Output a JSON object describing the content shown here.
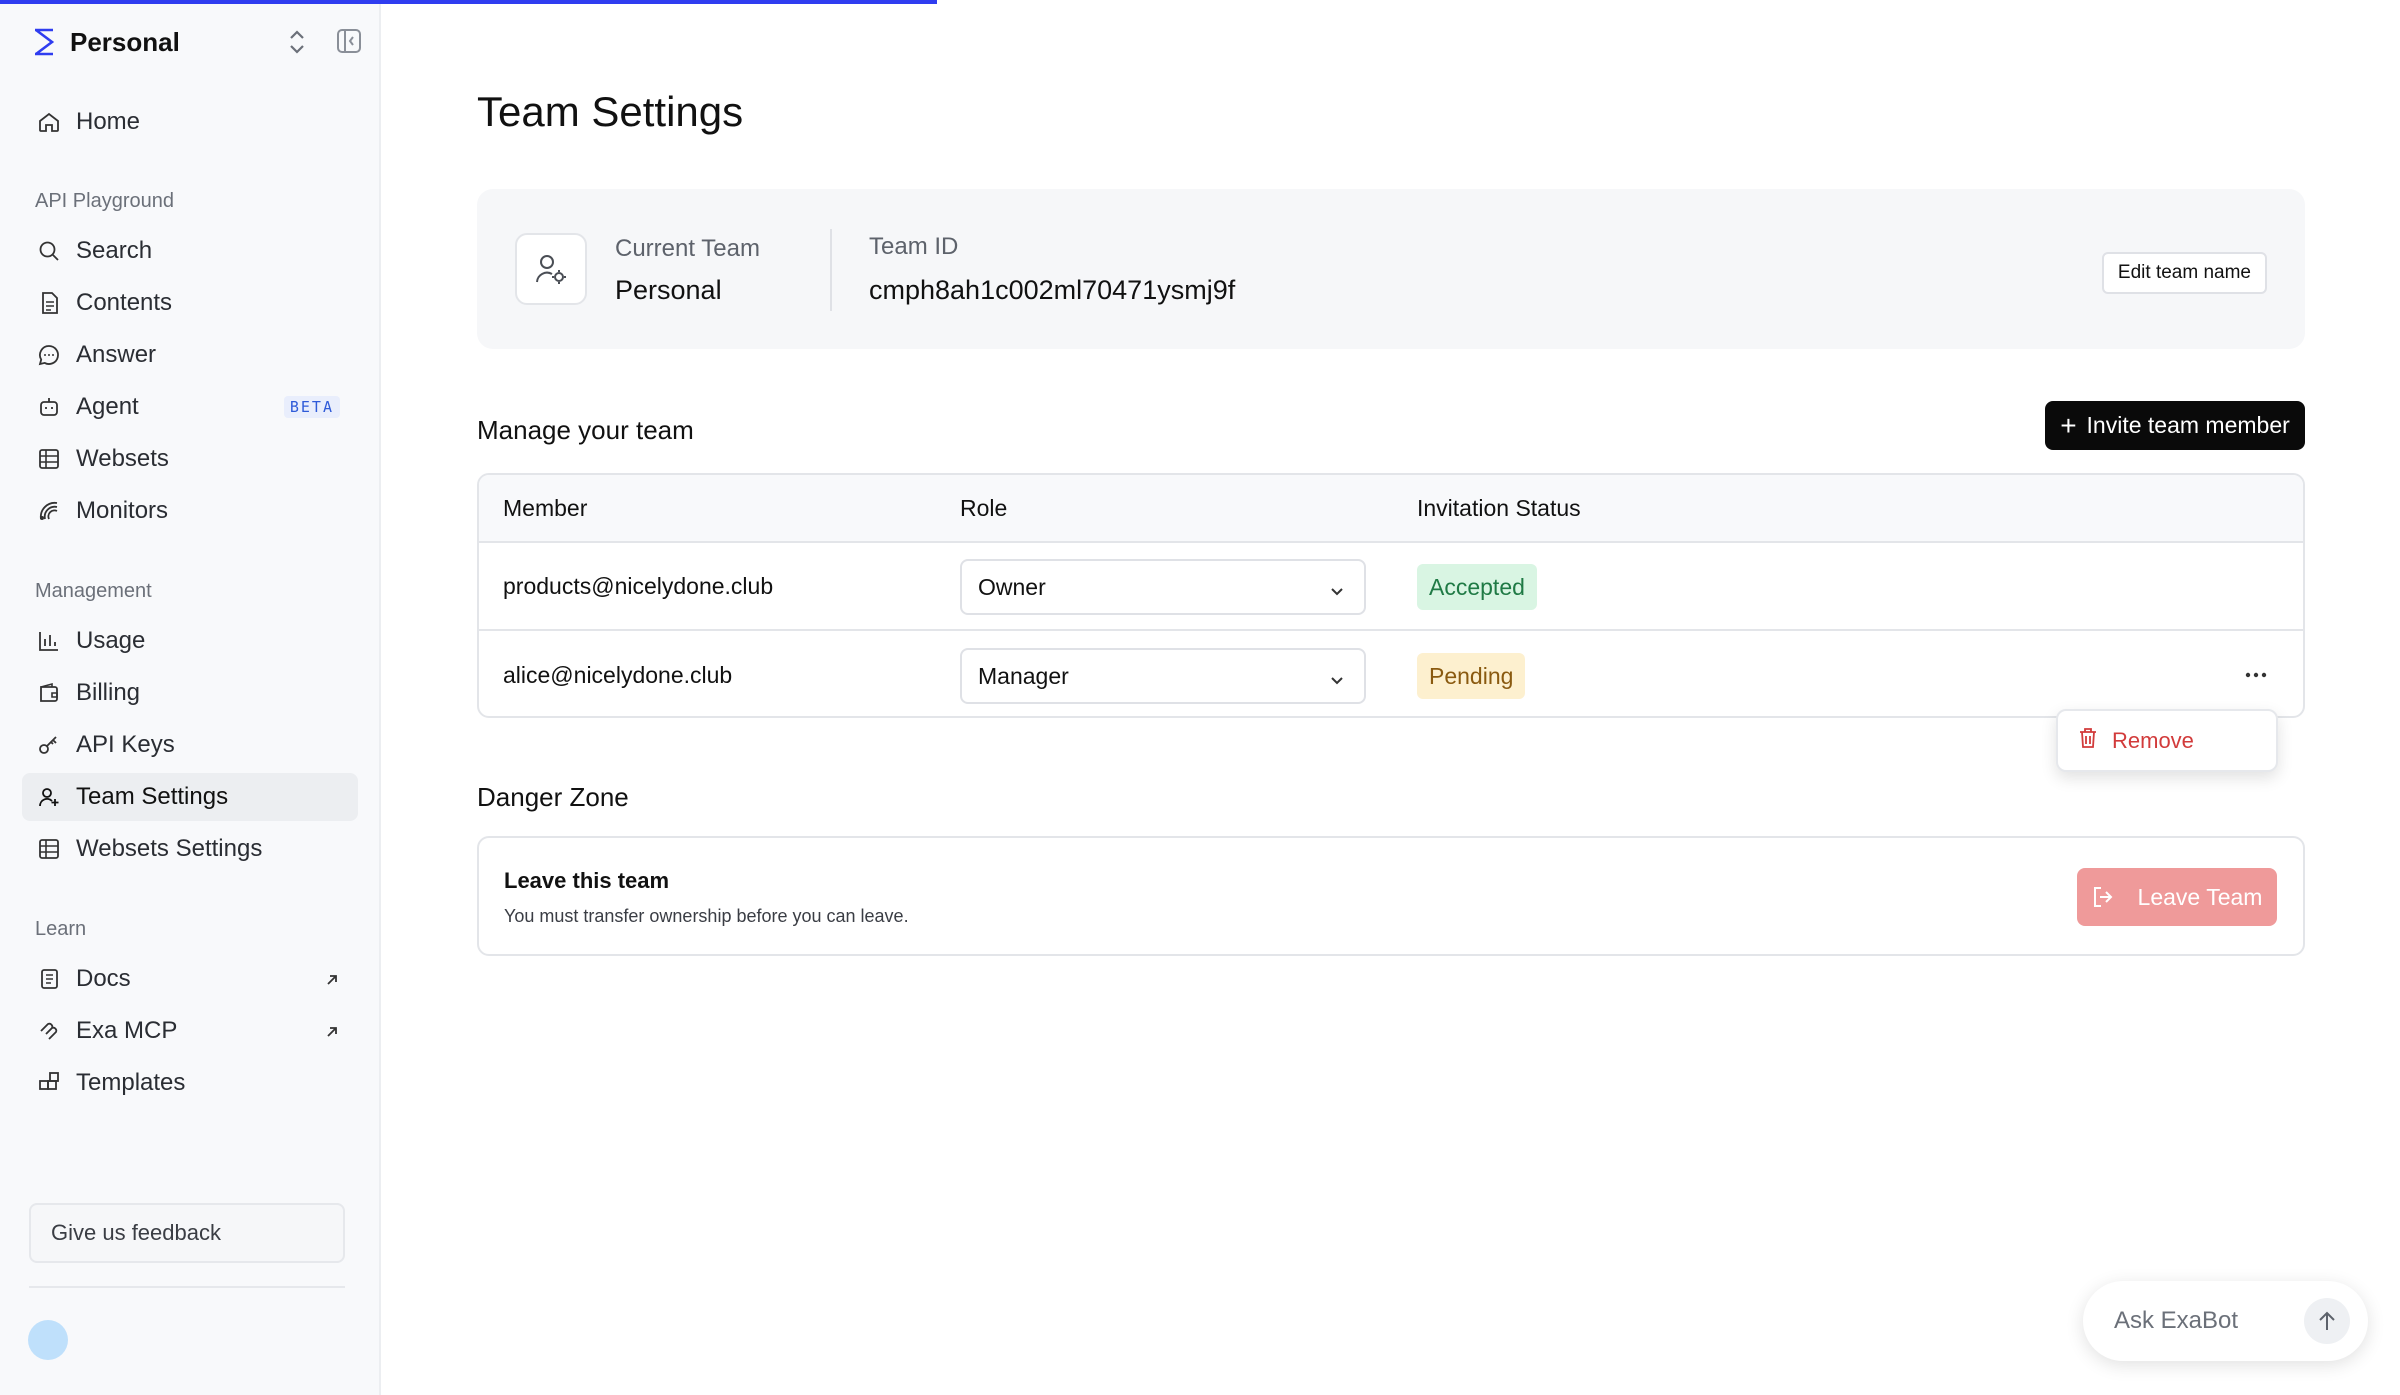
{
  "sidebar": {
    "team_name": "Personal",
    "home": "Home",
    "sections": {
      "api_playground": "API Playground",
      "management": "Management",
      "learn": "Learn"
    },
    "items": {
      "search": "Search",
      "contents": "Contents",
      "answer": "Answer",
      "agent": "Agent",
      "agent_badge": "BETA",
      "websets": "Websets",
      "monitors": "Monitors",
      "usage": "Usage",
      "billing": "Billing",
      "api_keys": "API Keys",
      "team_settings": "Team Settings",
      "websets_settings": "Websets Settings",
      "docs": "Docs",
      "exa_mcp": "Exa MCP",
      "templates": "Templates"
    },
    "active_item": "Team Settings",
    "feedback": "Give us feedback",
    "icons": [
      "exa-logo-icon",
      "chevron-updown-icon",
      "sidebar-collapse-icon",
      "home-icon",
      "search-icon",
      "document-icon",
      "chat-bubble-icon",
      "robot-icon",
      "grid-icon",
      "radar-icon",
      "bar-chart-icon",
      "wallet-icon",
      "key-icon",
      "user-plus-icon",
      "book-icon",
      "mcp-icon",
      "templates-icon",
      "external-link-icon"
    ]
  },
  "page": {
    "title": "Team Settings"
  },
  "team_card": {
    "current_team_label": "Current Team",
    "current_team_value": "Personal",
    "team_id_label": "Team ID",
    "team_id_value": "cmph8ah1c002ml70471ysmj9f",
    "edit_button": "Edit team name"
  },
  "manage": {
    "heading": "Manage your team",
    "invite_button": "Invite team member",
    "columns": [
      "Member",
      "Role",
      "Invitation Status"
    ],
    "rows": [
      {
        "email": "products@nicelydone.club",
        "role": "Owner",
        "status": "Accepted"
      },
      {
        "email": "alice@nicelydone.club",
        "role": "Manager",
        "status": "Pending"
      }
    ],
    "row_menu": {
      "remove": "Remove"
    }
  },
  "danger": {
    "heading": "Danger Zone",
    "title": "Leave this team",
    "subtitle": "You must transfer ownership before you can leave.",
    "leave_button": "Leave Team"
  },
  "askbot": {
    "placeholder": "Ask ExaBot"
  },
  "colors": {
    "accent": "#2f3df0",
    "accepted_bg": "#d9f5e3",
    "pending_bg": "#fdf0cf",
    "danger": "#d23b3b",
    "danger_button": "#ef9a9a"
  }
}
